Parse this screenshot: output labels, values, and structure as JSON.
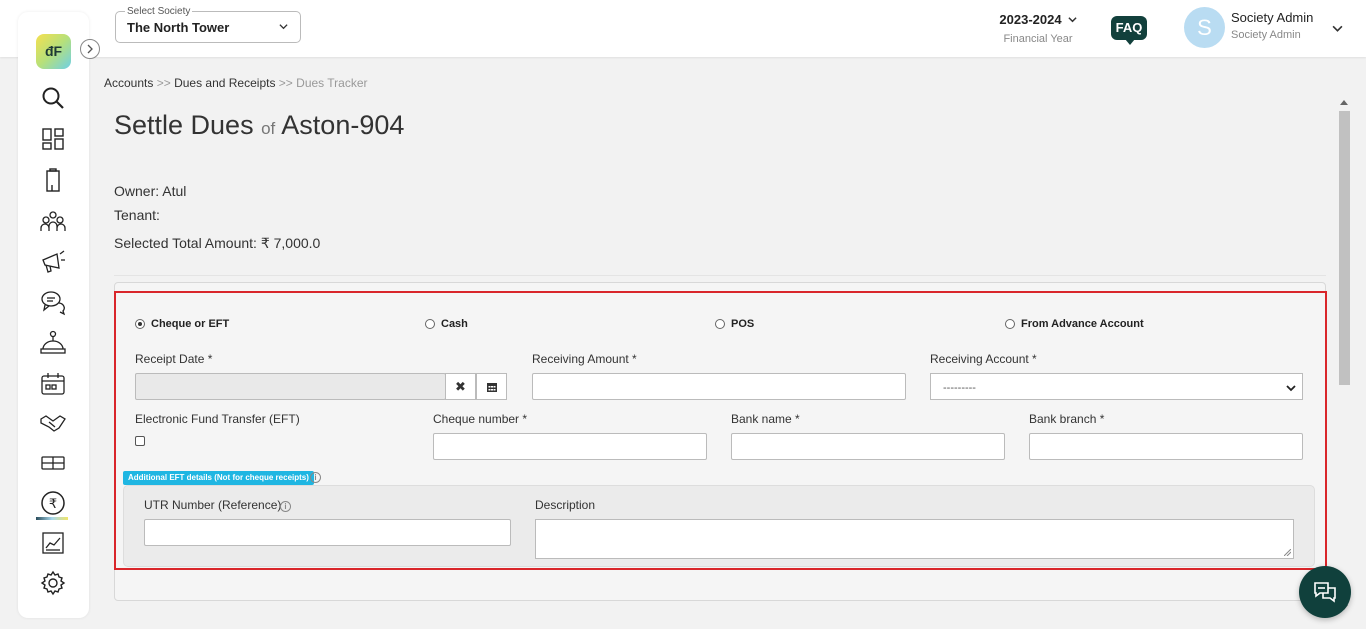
{
  "header": {
    "society_select_label": "Select Society",
    "society_value": "The North Tower",
    "financial_year": "2023-2024",
    "financial_year_label": "Financial Year",
    "faq_label": "FAQ",
    "avatar_initial": "S",
    "user_name": "Society Admin",
    "user_role": "Society Admin"
  },
  "sidebar": {
    "logo_text": "đF",
    "items": [
      {
        "icon": "search-icon"
      },
      {
        "icon": "dashboard-icon"
      },
      {
        "icon": "building-icon"
      },
      {
        "icon": "members-icon"
      },
      {
        "icon": "announcement-icon"
      },
      {
        "icon": "chat-icon"
      },
      {
        "icon": "helpdesk-icon"
      },
      {
        "icon": "calendar-icon"
      },
      {
        "icon": "handshake-icon"
      },
      {
        "icon": "ticket-icon"
      },
      {
        "icon": "rupee-icon",
        "active": true
      },
      {
        "icon": "reports-icon"
      },
      {
        "icon": "settings-icon"
      }
    ]
  },
  "breadcrumb": {
    "item1": "Accounts",
    "sep1": ">>",
    "item2": "Dues and Receipts",
    "sep2": ">>",
    "current": "Dues Tracker"
  },
  "page": {
    "title": "Settle Dues",
    "of": "of",
    "unit": "Aston-904",
    "owner": "Owner: Atul",
    "tenant": "Tenant:",
    "total": "Selected Total Amount: ₹  7,000.0"
  },
  "form": {
    "payment_modes": [
      {
        "label": "Cheque or EFT",
        "selected": true
      },
      {
        "label": "Cash",
        "selected": false
      },
      {
        "label": "POS",
        "selected": false
      },
      {
        "label": "From Advance Account",
        "selected": false
      }
    ],
    "receipt_date_label": "Receipt Date *",
    "receipt_date_value": "",
    "receiving_amount_label": "Receiving Amount *",
    "receiving_amount_value": "",
    "receiving_account_label": "Receiving Account *",
    "receiving_account_value": "---------",
    "eft_label": "Electronic Fund Transfer (EFT)",
    "cheque_number_label": "Cheque number *",
    "bank_name_label": "Bank name *",
    "bank_branch_label": "Bank branch *",
    "eft_tag": "Additional EFT details (Not for cheque receipts)",
    "utr_label": "UTR Number (Reference)",
    "description_label": "Description"
  },
  "colors": {
    "accent_dark": "#10403c",
    "highlight_border": "#d9262b",
    "eft_tag": "#1fb6e2"
  }
}
